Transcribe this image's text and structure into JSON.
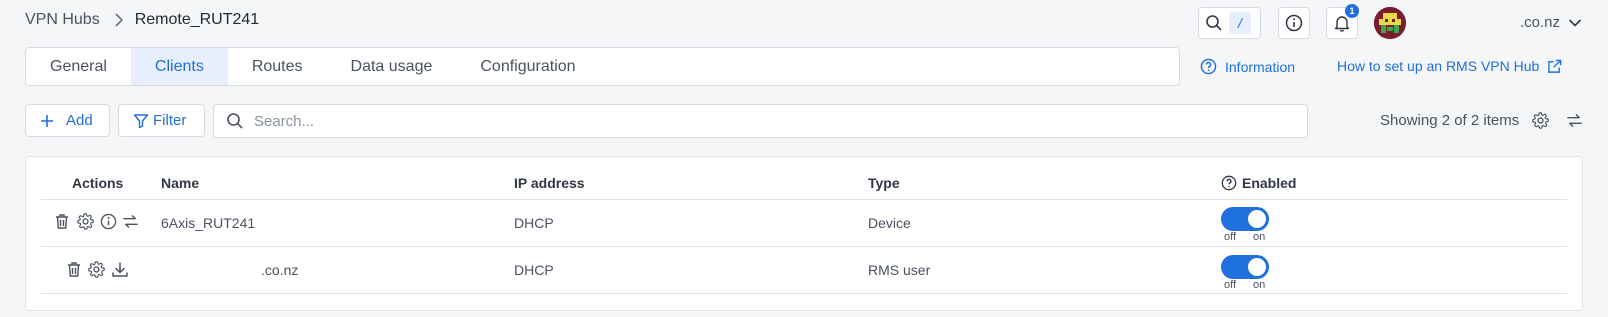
{
  "breadcrumb": {
    "root": "VPN Hubs",
    "current": "Remote_RUT241"
  },
  "header": {
    "search_shortcut": "/",
    "notification_count": "1",
    "user_suffix": ".co.nz"
  },
  "tabs": [
    {
      "label": "General"
    },
    {
      "label": "Clients"
    },
    {
      "label": "Routes"
    },
    {
      "label": "Data usage"
    },
    {
      "label": "Configuration"
    }
  ],
  "links": {
    "information": "Information",
    "howto": "How to set up an RMS VPN Hub"
  },
  "toolbar": {
    "add_label": "Add",
    "filter_label": "Filter",
    "search_placeholder": "Search...",
    "showing": "Showing 2 of 2 items"
  },
  "table": {
    "columns": {
      "actions": "Actions",
      "name": "Name",
      "ip": "IP address",
      "type": "Type",
      "enabled": "Enabled"
    },
    "rows": [
      {
        "name": "6Axis_RUT241",
        "ip": "DHCP",
        "type": "Device",
        "enabled": true,
        "off": "off",
        "on": "on"
      },
      {
        "name": ".co.nz",
        "ip": "DHCP",
        "type": "RMS user",
        "enabled": true,
        "off": "off",
        "on": "on"
      }
    ]
  },
  "colors": {
    "accent": "#1f6fdc",
    "tab_active_bg": "#e7efff",
    "background": "#f5f6f8"
  }
}
